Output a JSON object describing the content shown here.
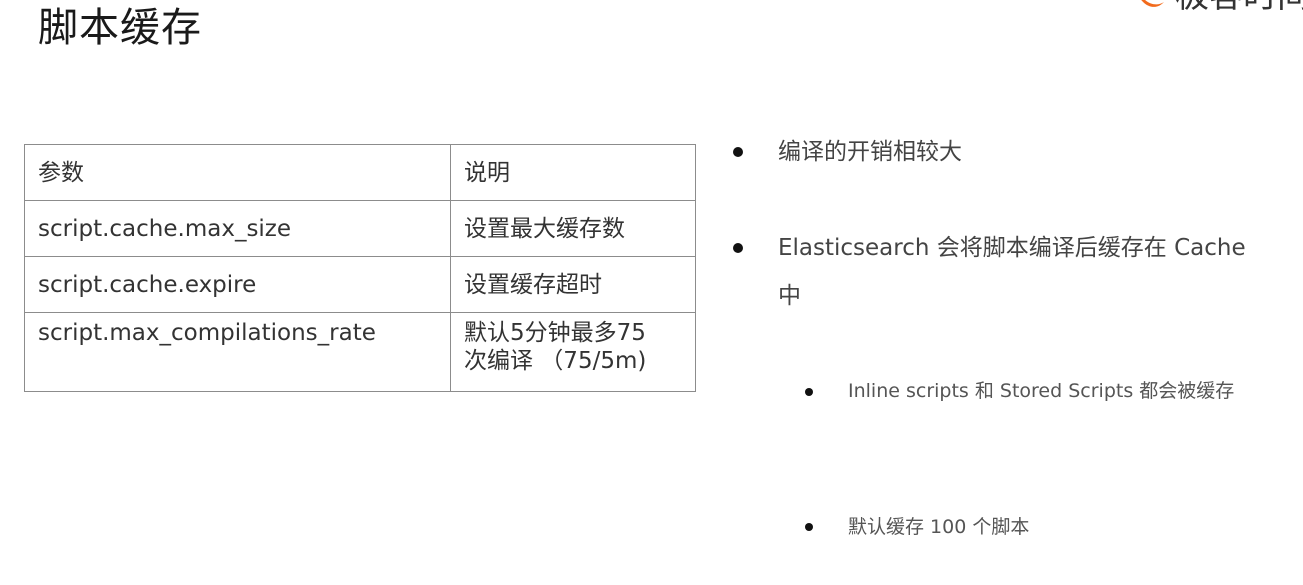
{
  "slide": {
    "title": "脚本缓存"
  },
  "logo": {
    "text": "极客时间",
    "mark_color": "#f26b1d"
  },
  "table": {
    "headers": [
      "参数",
      "说明"
    ],
    "rows": [
      [
        "script.cache.max_size",
        "设置最大缓存数"
      ],
      [
        "script.cache.expire",
        "设置缓存超时"
      ],
      [
        "script.max_compilations_rate",
        "默认5分钟最多75",
        "次编译 （75/5m)"
      ]
    ]
  },
  "bullets": {
    "main": [
      "编译的开销相较大",
      "Elasticsearch 会将脚本编译后缓存在 Cache 中"
    ],
    "sub": [
      "Inline scripts 和  Stored Scripts 都会被缓存",
      "默认缓存 100 个脚本"
    ]
  }
}
